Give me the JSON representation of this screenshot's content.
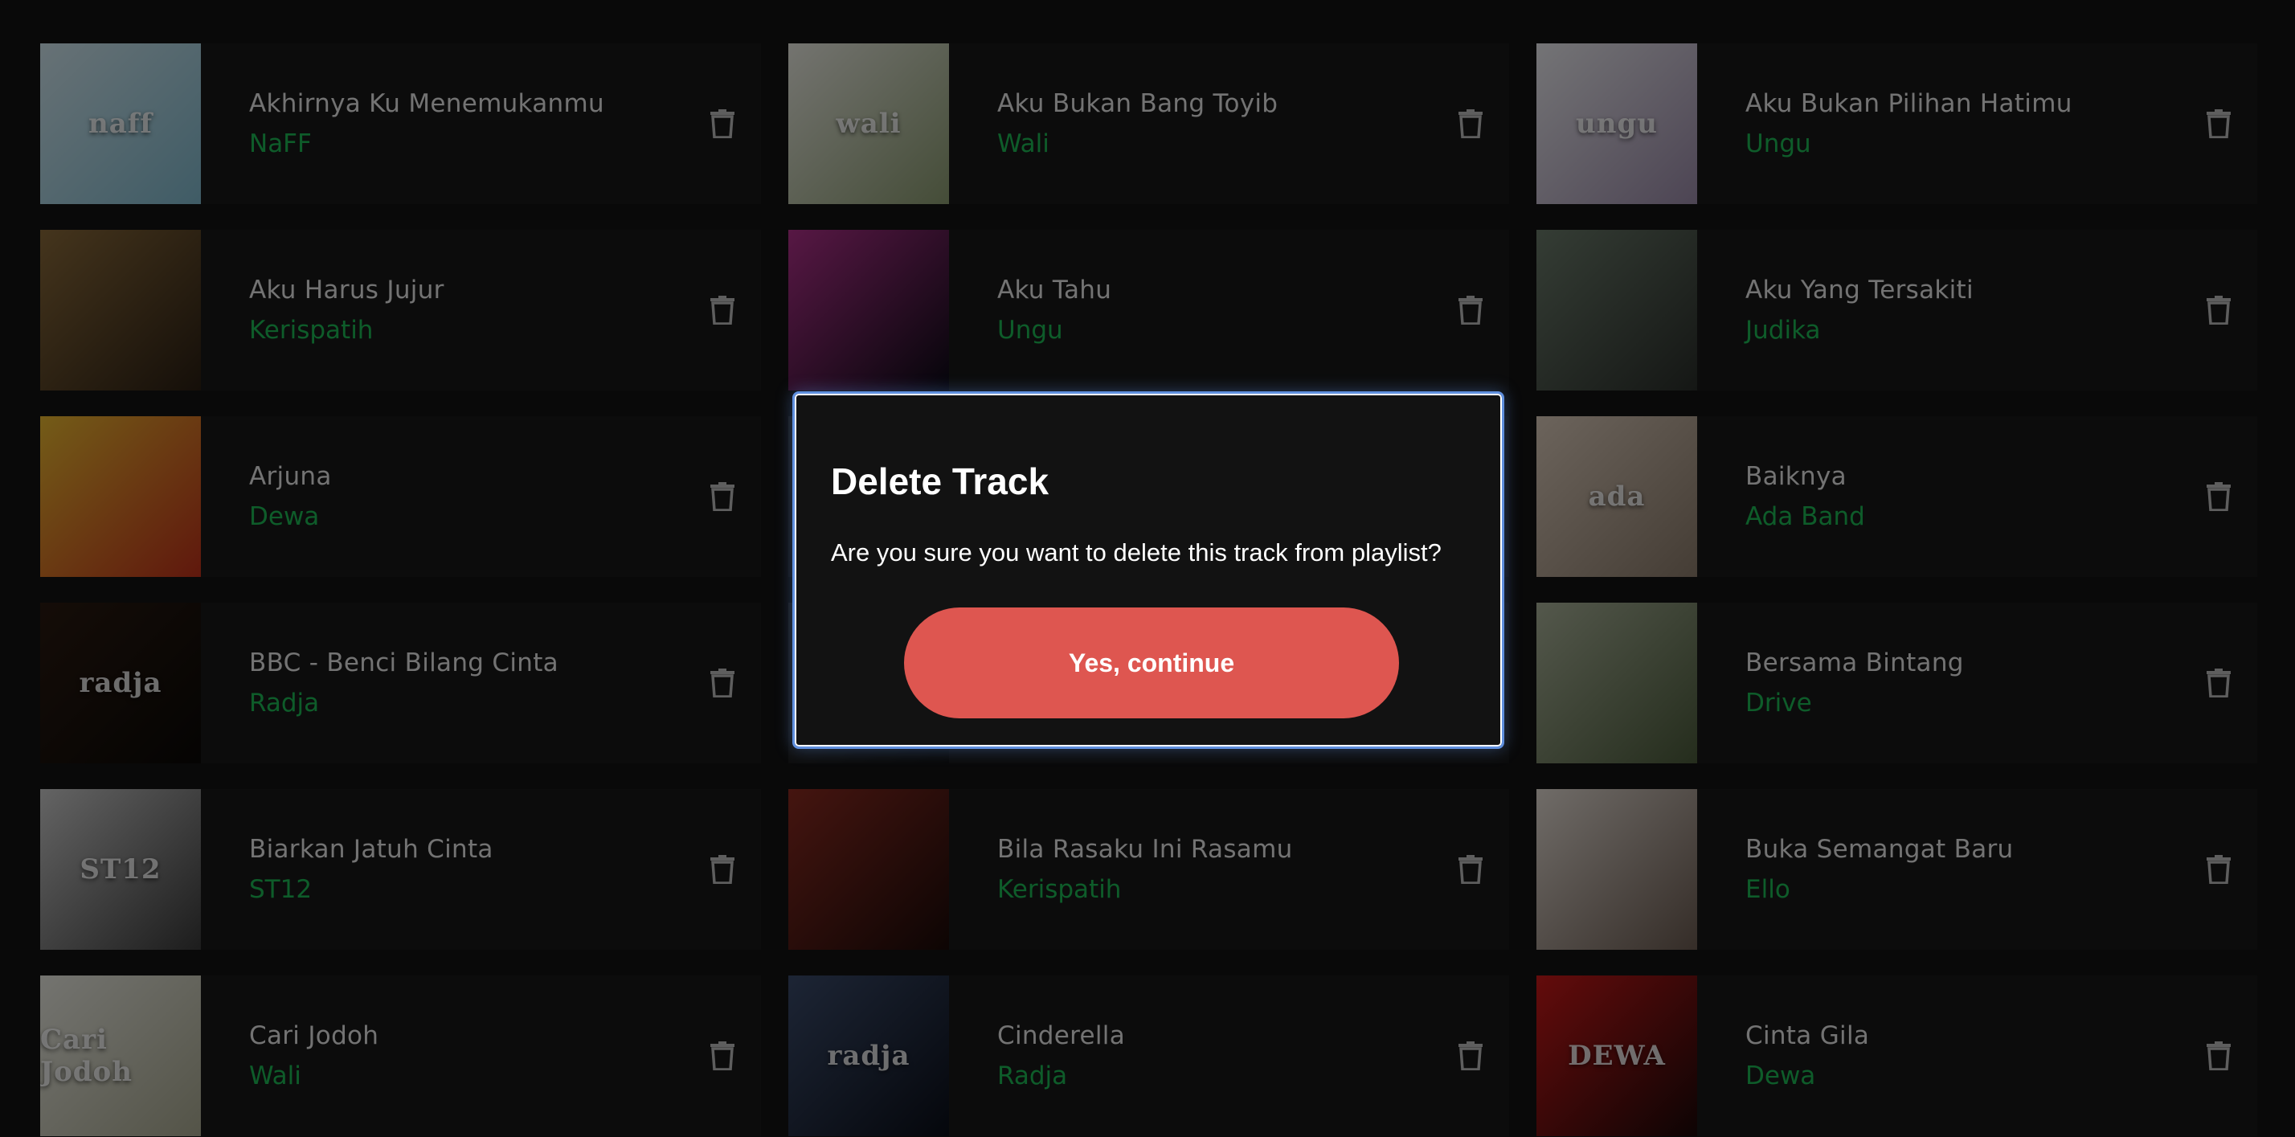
{
  "tracks": [
    {
      "title": "Akhirnya Ku Menemukanmu",
      "artist": "NaFF",
      "cover_text": "naff",
      "cover_colors": [
        "#cfe4ec",
        "#7fb8cc"
      ]
    },
    {
      "title": "Aku Bukan Bang Toyib",
      "artist": "Wali",
      "cover_text": "wali",
      "cover_colors": [
        "#e8e8e0",
        "#8a9a70"
      ]
    },
    {
      "title": "Aku Bukan Pilihan Hatimu",
      "artist": "Ungu",
      "cover_text": "ungu",
      "cover_colors": [
        "#e8e8ec",
        "#9a8aa8"
      ]
    },
    {
      "title": "Aku Harus Jujur",
      "artist": "Kerispatih",
      "cover_text": "",
      "cover_colors": [
        "#8a6a3a",
        "#2a1e12"
      ]
    },
    {
      "title": "Aku Tahu",
      "artist": "Ungu",
      "cover_text": "",
      "cover_colors": [
        "#b0308a",
        "#0a0a14"
      ]
    },
    {
      "title": "Aku Yang Tersakiti",
      "artist": "Judika",
      "cover_text": "",
      "cover_colors": [
        "#6a7a6a",
        "#2a2e2a"
      ]
    },
    {
      "title": "Arjuna",
      "artist": "Dewa",
      "cover_text": "",
      "cover_colors": [
        "#e8b830",
        "#c0301a"
      ]
    },
    {
      "title": "",
      "artist": "",
      "cover_text": "",
      "cover_colors": [
        "#2a2a2a",
        "#111111"
      ]
    },
    {
      "title": "Baiknya",
      "artist": "Ada Band",
      "cover_text": "ada",
      "cover_colors": [
        "#d8c8b8",
        "#8a7a6a"
      ]
    },
    {
      "title": "BBC - Benci Bilang Cinta",
      "artist": "Radja",
      "cover_text": "radja",
      "cover_colors": [
        "#2a1a10",
        "#0a0806"
      ]
    },
    {
      "title": "",
      "artist": "",
      "cover_text": "",
      "cover_colors": [
        "#2a2a2a",
        "#111111"
      ]
    },
    {
      "title": "Bersama Bintang",
      "artist": "Drive",
      "cover_text": "",
      "cover_colors": [
        "#a8b098",
        "#4a5a3a"
      ]
    },
    {
      "title": "Biarkan Jatuh Cinta",
      "artist": "ST12",
      "cover_text": "ST12",
      "cover_colors": [
        "#c8c8c8",
        "#3a3a3a"
      ]
    },
    {
      "title": "Bila Rasaku Ini Rasamu",
      "artist": "Kerispatih",
      "cover_text": "",
      "cover_colors": [
        "#8a2a20",
        "#1a0a08"
      ]
    },
    {
      "title": "Buka Semangat Baru",
      "artist": "Ello",
      "cover_text": "",
      "cover_colors": [
        "#e0d8d0",
        "#6a5a50"
      ]
    },
    {
      "title": "Cari Jodoh",
      "artist": "Wali",
      "cover_text": "Cari Jodoh",
      "cover_colors": [
        "#e8e8e0",
        "#a8a890"
      ]
    },
    {
      "title": "Cinderella",
      "artist": "Radja",
      "cover_text": "radja",
      "cover_colors": [
        "#3a4a6a",
        "#0a0e18"
      ]
    },
    {
      "title": "Cinta Gila",
      "artist": "Dewa",
      "cover_text": "DEWA",
      "cover_colors": [
        "#c81818",
        "#1a0808"
      ]
    }
  ],
  "dialog": {
    "title": "Delete Track",
    "message": "Are you sure you want to delete this track from playlist?",
    "confirm_label": "Yes, continue"
  },
  "colors": {
    "accent_green": "#1db954",
    "danger": "#de5650",
    "focus_ring": "#5f8fde"
  }
}
